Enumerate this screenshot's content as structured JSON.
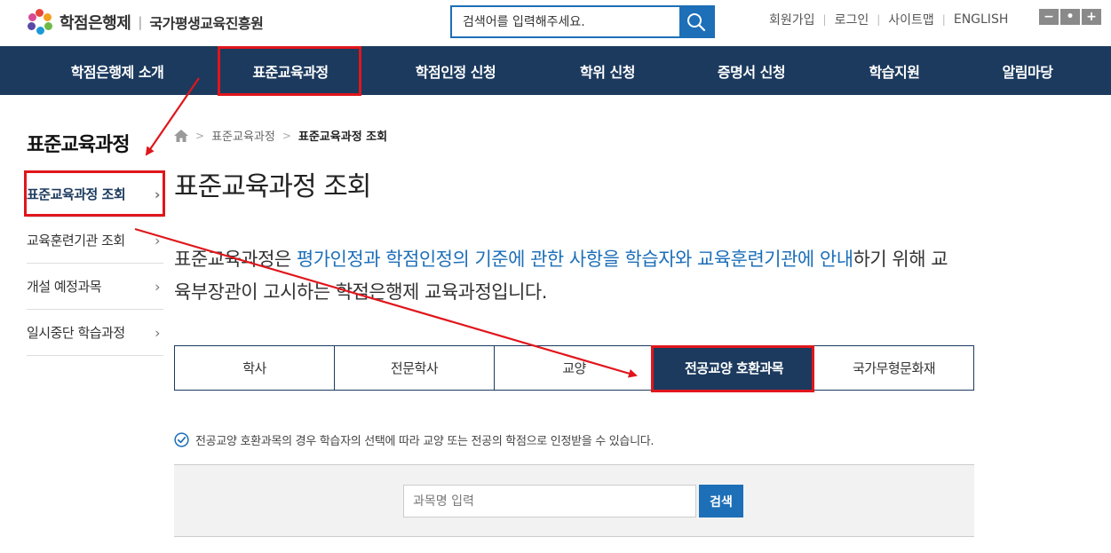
{
  "header": {
    "logo_title": "학점은행제",
    "logo_separator": "|",
    "logo_org": "국가평생교육진흥원",
    "search_placeholder": "검색어를 입력해주세요.",
    "util_links": [
      "회원가입",
      "로그인",
      "사이트맵",
      "ENGLISH"
    ],
    "zoom_buttons": [
      "−",
      "•",
      "+"
    ]
  },
  "gnb": {
    "items": [
      "학점은행제 소개",
      "표준교육과정",
      "학점인정 신청",
      "학위 신청",
      "증명서 신청",
      "학습지원",
      "알림마당"
    ]
  },
  "sidebar": {
    "title": "표준교육과정",
    "items": [
      {
        "label": "표준교육과정 조회",
        "active": true
      },
      {
        "label": "교육훈련기관 조회",
        "active": false
      },
      {
        "label": "개설 예정과목",
        "active": false
      },
      {
        "label": "일시중단 학습과정",
        "active": false
      }
    ],
    "chevron": "›"
  },
  "breadcrumb": {
    "items": [
      "표준교육과정",
      "표준교육과정 조회"
    ]
  },
  "main": {
    "title": "표준교육과정 조회",
    "intro_part1": "표준교육과정은 ",
    "intro_highlight": "평가인정과 학점인정의 기준에 관한 사항을 학습자와 교육훈련기관에 안내",
    "intro_part2": "하기 위해 교육부장관이 고시하는 학점은행제 교육과정입니다.",
    "tabs": [
      {
        "label": "학사",
        "active": false
      },
      {
        "label": "전문학사",
        "active": false
      },
      {
        "label": "교양",
        "active": false
      },
      {
        "label": "전공교양 호환과목",
        "active": true
      },
      {
        "label": "국가무형문화재",
        "active": false
      }
    ],
    "note": "전공교양 호환과목의 경우 학습자의 선택에 따라 교양 또는 전공의 학점으로 인정받을 수 있습니다.",
    "search_placeholder": "과목명 입력",
    "search_button": "검색"
  },
  "colors": {
    "navy": "#1c3a5e",
    "blue": "#1d6fb8",
    "annotation_red": "#e0161c"
  }
}
